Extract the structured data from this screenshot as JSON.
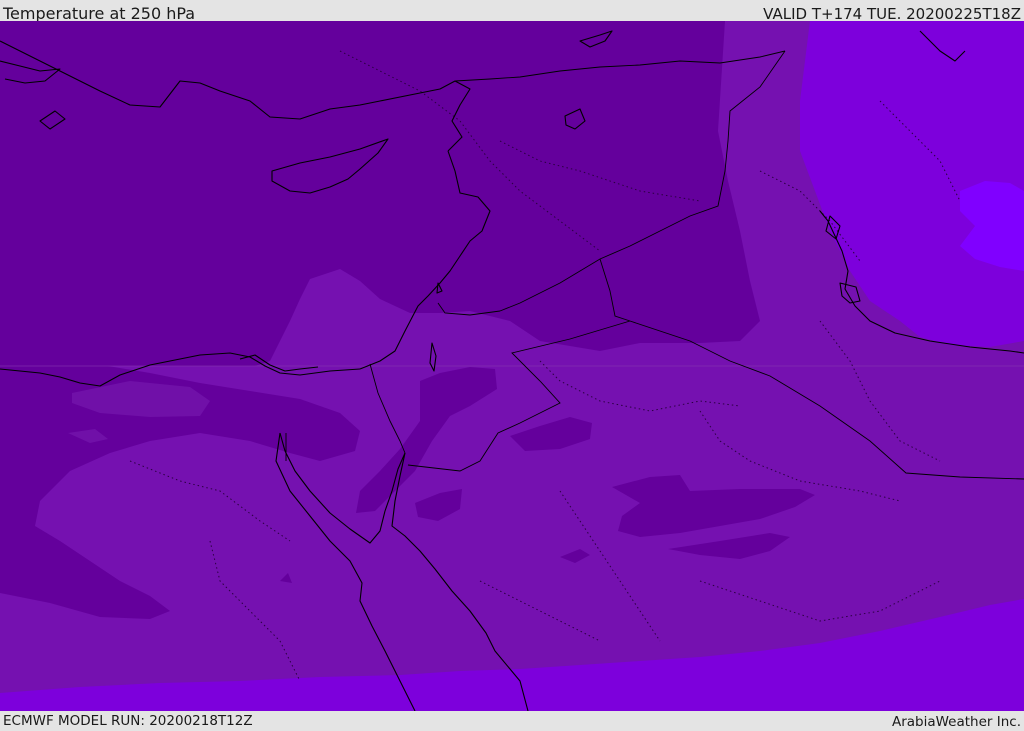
{
  "header": {
    "title": "Temperature at 250 hPa",
    "valid_time": "VALID T+174 TUE. 20200225T18Z"
  },
  "footer": {
    "model_run": "ECMWF MODEL RUN: 20200218T12Z",
    "credit": "ArabiaWeather Inc."
  },
  "map": {
    "field": "temperature",
    "level": "250 hPa",
    "palette": {
      "coldest": "#5c0091",
      "cold": "#6a009e",
      "mid": "#7611b0",
      "warm": "#7d00dc",
      "warmest": "#8000ff"
    },
    "coastline_color": "#000000",
    "border_style": "dotted"
  }
}
